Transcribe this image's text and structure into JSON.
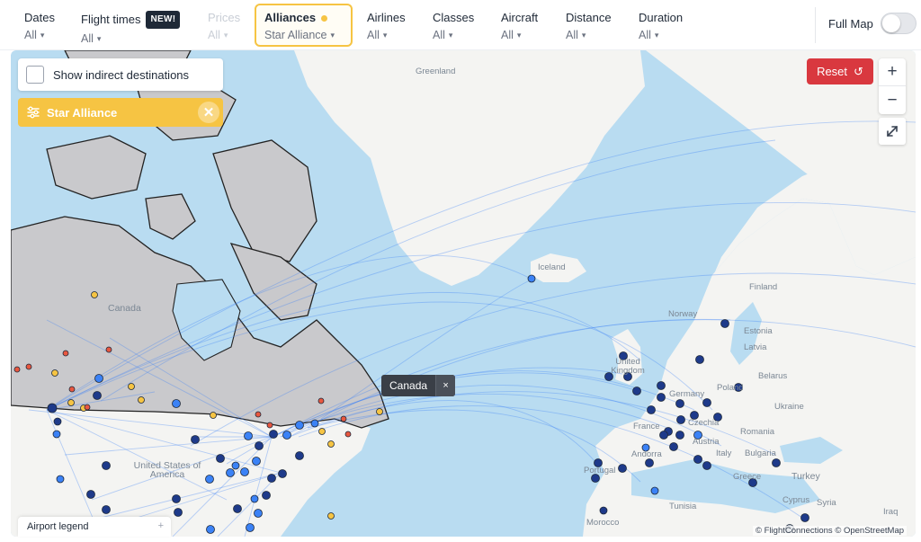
{
  "filters": [
    {
      "label": "Dates",
      "value": "All",
      "badge": "",
      "state": "normal"
    },
    {
      "label": "Flight times",
      "value": "All",
      "badge": "NEW!",
      "state": "normal"
    },
    {
      "label": "Prices",
      "value": "All",
      "badge": "",
      "state": "disabled"
    },
    {
      "label": "Alliances",
      "value": "Star Alliance",
      "badge": "",
      "state": "active"
    },
    {
      "label": "Airlines",
      "value": "All",
      "badge": "",
      "state": "normal"
    },
    {
      "label": "Classes",
      "value": "All",
      "badge": "",
      "state": "normal"
    },
    {
      "label": "Aircraft",
      "value": "All",
      "badge": "",
      "state": "normal"
    },
    {
      "label": "Distance",
      "value": "All",
      "badge": "",
      "state": "normal"
    },
    {
      "label": "Duration",
      "value": "All",
      "badge": "",
      "state": "normal"
    }
  ],
  "full_map": {
    "label": "Full Map",
    "enabled": false
  },
  "indirect": {
    "label": "Show indirect destinations",
    "checked": false
  },
  "alliance_chip": {
    "label": "Star Alliance"
  },
  "reset": {
    "label": "Reset"
  },
  "zoom": {
    "in": "+",
    "out": "−"
  },
  "tooltip": {
    "label": "Canada",
    "close": "×"
  },
  "legend": {
    "label": "Airport legend",
    "expand": "+"
  },
  "attribution": "© FlightConnections © OpenStreetMap",
  "map_labels": [
    "Greenland",
    "Iceland",
    "Canada",
    "United States of America",
    "United Kingdom",
    "Norway",
    "Finland",
    "Estonia",
    "Latvia",
    "Belarus",
    "Poland",
    "Germany",
    "Czechia",
    "Ukraine",
    "France",
    "Austria",
    "Italy",
    "Romania",
    "Bulgaria",
    "Andorra",
    "Portugal",
    "Greece",
    "Turkey",
    "Cyprus",
    "Syria",
    "Iraq",
    "Tunisia",
    "Morocco"
  ],
  "colors": {
    "accent": "#f6c443",
    "reset": "#d9383f",
    "ocean": "#b9dcf1",
    "highlight_land": "#c9c9cc",
    "route": "#3b82f6",
    "airport_dark": "#1e3a8a",
    "airport_light": "#3b82f6",
    "airport_yellow": "#f6c443",
    "airport_red": "#e8573f"
  },
  "icons": [
    "chevron-down-icon",
    "sliders-icon",
    "close-icon",
    "refresh-icon",
    "plus-icon",
    "minus-icon",
    "expand-icon"
  ]
}
